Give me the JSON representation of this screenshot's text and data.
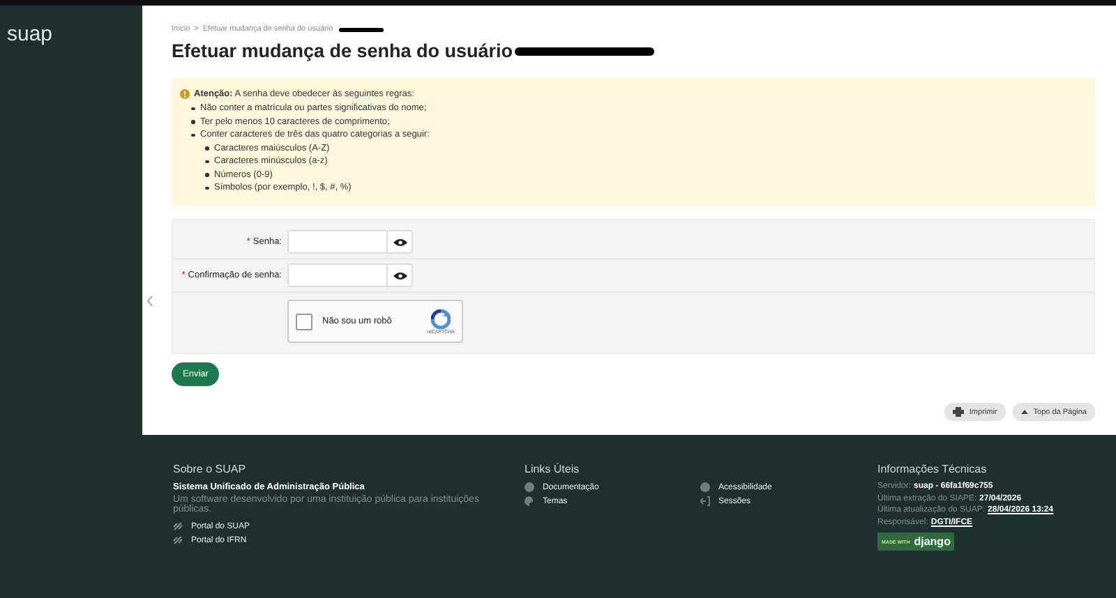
{
  "sidebar": {
    "logo": "suap"
  },
  "breadcrumb": {
    "separator": ">",
    "items": [
      {
        "label": "Início"
      },
      {
        "label": "Efetuar mudança de senha do usuário"
      }
    ]
  },
  "title": {
    "text": "Efetuar mudança de senha do usuário"
  },
  "alert": {
    "text": "**Atenção:** A senha deve obedecer às seguintes regras:",
    "rules": [
      {
        "text": "Não conter a matrícula ou partes significativas do nome;"
      },
      {
        "text": "Ter pelo menos 10 caracteres de comprimento;"
      },
      {
        "text": "Conter caracteres de três das quatro categorias a seguir:",
        "children": [
          {
            "text": "Caracteres maiúsculos (A-Z)"
          },
          {
            "text": "Caracteres minúsculos (a-z)"
          },
          {
            "text": "Números (0-9)"
          },
          {
            "text": "Símbolos (por exemplo, !, $, #, %)"
          }
        ]
      }
    ]
  },
  "form": {
    "fields": [
      {
        "required_mark": "*",
        "label": "Senha:"
      },
      {
        "required_mark": "*",
        "label": "Confirmação de senha:"
      }
    ],
    "captcha": {
      "label": "Não sou um robô",
      "brand": "reCAPTCHA",
      "checked": false
    },
    "submit": "Enviar"
  },
  "page_actions": [
    {
      "label": "Imprimir",
      "kind": "print"
    },
    {
      "label": "Topo da Página",
      "kind": "top"
    }
  ],
  "footer": {
    "about": {
      "heading": "Sobre o SUAP",
      "name": "Sistema Unificado de Administração Pública",
      "description": "Um software desenvolvido por uma instituição pública para instituições públicas.",
      "links": [
        "Portal do SUAP",
        "Portal do IFRN"
      ]
    },
    "useful_links": {
      "heading": "Links Úteis",
      "links": [
        {
          "label": "Documentação",
          "kind": "info"
        },
        {
          "label": "Acessibilidade",
          "kind": "info"
        },
        {
          "label": "Temas",
          "kind": "palette"
        },
        {
          "label": "Sessões",
          "kind": "exit"
        }
      ]
    },
    "tech": {
      "heading": "Informações Técnicas",
      "rows": [
        {
          "label": "Servidor:",
          "value": "suap - 66fa1f69c755",
          "link": false
        },
        {
          "label": "Última extração do SIAPE:",
          "value": "27/04/2026",
          "link": false
        },
        {
          "label": "Última atualização do SUAP:",
          "value": "28/04/2026 13:24",
          "link": true
        },
        {
          "label": "Responsável:",
          "value": "DGTI/IFCE",
          "link": true
        }
      ],
      "badge_small": "MADE WITH",
      "badge_big": "django"
    }
  }
}
